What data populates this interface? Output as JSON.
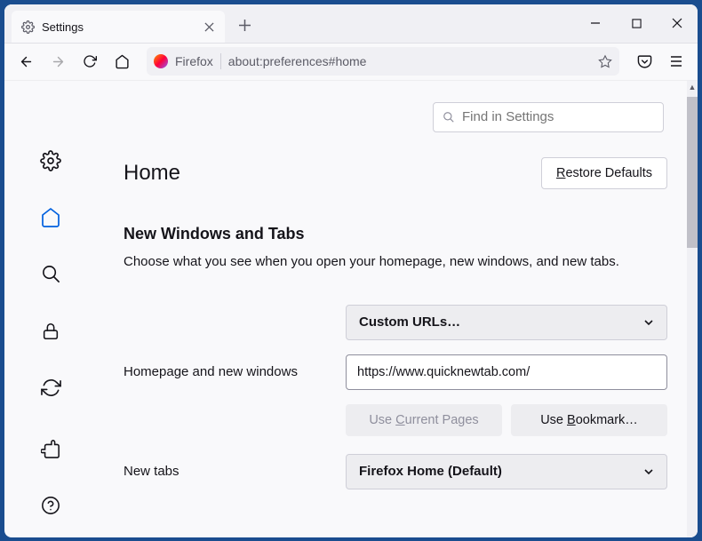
{
  "tab": {
    "title": "Settings"
  },
  "urlbar": {
    "identity": "Firefox",
    "url": "about:preferences#home"
  },
  "search": {
    "placeholder": "Find in Settings"
  },
  "page": {
    "title": "Home",
    "restore_btn": "Restore Defaults",
    "section_heading": "New Windows and Tabs",
    "section_desc": "Choose what you see when you open your homepage, new windows, and new tabs."
  },
  "homepage": {
    "mode_selected": "Custom URLs…",
    "label": "Homepage and new windows",
    "url_value": "https://www.quicknewtab.com/",
    "use_current": "Use Current Pages",
    "use_bookmark": "Use Bookmark…"
  },
  "newtabs": {
    "label": "New tabs",
    "selected": "Firefox Home (Default)"
  }
}
